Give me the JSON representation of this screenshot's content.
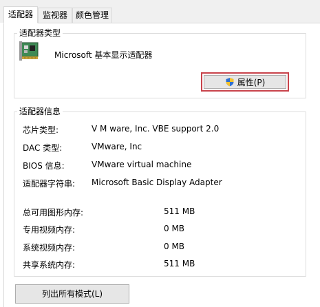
{
  "tabs": [
    {
      "label": "适配器",
      "active": true
    },
    {
      "label": "监视器",
      "active": false
    },
    {
      "label": "颜色管理",
      "active": false
    }
  ],
  "adapter_type": {
    "group_title": "适配器类型",
    "name": "Microsoft 基本显示适配器",
    "properties_button": "属性(P)",
    "icon": "video-card-icon"
  },
  "adapter_info": {
    "group_title": "适配器信息",
    "rows": [
      {
        "label": "芯片类型:",
        "value": "V M ware, Inc. VBE support 2.0"
      },
      {
        "label": "DAC 类型:",
        "value": "VMware, Inc"
      },
      {
        "label": "BIOS 信息:",
        "value": "VMware virtual machine"
      },
      {
        "label": "适配器字符串:",
        "value": "Microsoft Basic Display Adapter"
      }
    ],
    "memory": [
      {
        "label": "总可用图形内存:",
        "value": "511 MB"
      },
      {
        "label": "专用视频内存:",
        "value": "0 MB"
      },
      {
        "label": "系统视频内存:",
        "value": "0 MB"
      },
      {
        "label": "共享系统内存:",
        "value": "511 MB"
      }
    ]
  },
  "list_modes_button": "列出所有模式(L)",
  "colors": {
    "highlight_border": "#c8434b",
    "button_face": "#e6e6e6"
  }
}
